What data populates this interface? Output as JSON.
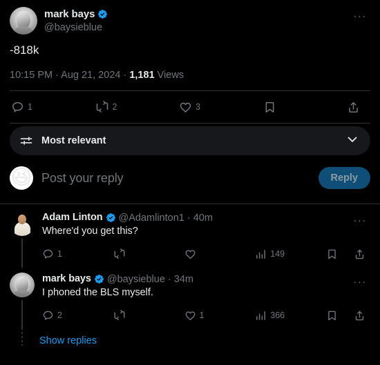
{
  "main_tweet": {
    "author": {
      "display_name": "mark bays",
      "handle": "@baysieblue",
      "verified": true,
      "avatar": "grayscale-bust-portrait"
    },
    "text": "-818k",
    "meta": {
      "time": "10:15 PM",
      "separator": " · ",
      "date": "Aug 21, 2024",
      "views_count": "1,181",
      "views_label": "Views"
    },
    "more_menu": "···",
    "actions": [
      {
        "name": "reply",
        "icon": "comment-icon",
        "count": "1"
      },
      {
        "name": "retweet",
        "icon": "retweet-icon",
        "count": "2"
      },
      {
        "name": "like",
        "icon": "heart-icon",
        "count": "3"
      },
      {
        "name": "bookmark",
        "icon": "bookmark-icon",
        "count": ""
      },
      {
        "name": "share",
        "icon": "share-icon",
        "count": ""
      }
    ]
  },
  "sort_bar": {
    "icon": "sliders-icon",
    "label": "Most relevant",
    "chevron": "chevron-down-icon"
  },
  "composer": {
    "avatar": "laughing-emoji",
    "emoji": "😆",
    "placeholder": "Post your reply",
    "reply_button": "Reply",
    "reply_button_color": "#0f4f77"
  },
  "replies": [
    {
      "author": {
        "display_name": "Adam Linton",
        "handle": "@Adamlinton1",
        "verified": true,
        "avatar": "photo-man-light-shirt"
      },
      "timestamp": "40m",
      "separator": " · ",
      "text": "Where'd you get this?",
      "more_menu": "···",
      "actions": [
        {
          "name": "reply",
          "icon": "comment-icon",
          "count": "1"
        },
        {
          "name": "retweet",
          "icon": "retweet-icon",
          "count": ""
        },
        {
          "name": "like",
          "icon": "heart-icon",
          "count": ""
        },
        {
          "name": "views",
          "icon": "analytics-icon",
          "count": "149"
        },
        {
          "name": "bookmark",
          "icon": "bookmark-icon",
          "count": ""
        },
        {
          "name": "share",
          "icon": "share-icon",
          "count": ""
        }
      ]
    },
    {
      "author": {
        "display_name": "mark bays",
        "handle": "@baysieblue",
        "verified": true,
        "avatar": "grayscale-bust-portrait"
      },
      "timestamp": "34m",
      "separator": " · ",
      "text": "I phoned the BLS myself.",
      "more_menu": "···",
      "actions": [
        {
          "name": "reply",
          "icon": "comment-icon",
          "count": "2"
        },
        {
          "name": "retweet",
          "icon": "retweet-icon",
          "count": ""
        },
        {
          "name": "like",
          "icon": "heart-icon",
          "count": "1"
        },
        {
          "name": "views",
          "icon": "analytics-icon",
          "count": "366"
        },
        {
          "name": "bookmark",
          "icon": "bookmark-icon",
          "count": ""
        },
        {
          "name": "share",
          "icon": "share-icon",
          "count": ""
        }
      ]
    }
  ],
  "show_replies_link": "Show replies",
  "colors": {
    "background": "#000000",
    "text_primary": "#e7e9ea",
    "text_secondary": "#71767b",
    "accent_blue": "#1d9bf0",
    "verified_blue": "#1d9bf0",
    "divider": "#2f3336",
    "sort_bar_bg": "#16181c"
  }
}
